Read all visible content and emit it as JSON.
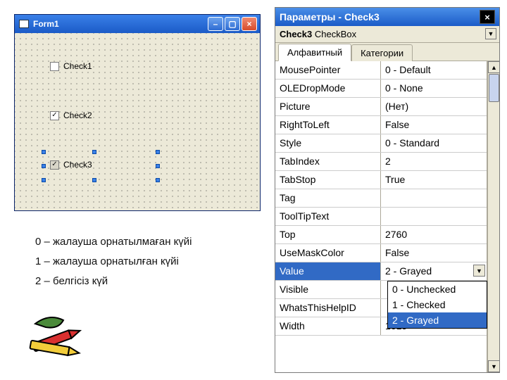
{
  "form": {
    "title": "Form1",
    "check1_label": "Check1",
    "check2_label": "Check2",
    "check3_label": "Check3"
  },
  "legend": {
    "l0": "0 – жалауша орнатылмаған күйі",
    "l1": "1 – жалауша орнатылған күйі",
    "l2": "2 – белгісіз күй"
  },
  "props": {
    "title": "Параметры - Check3",
    "object_name": "Check3",
    "object_type": "CheckBox",
    "tab_alpha": "Алфавитный",
    "tab_cat": "Категории",
    "rows": [
      {
        "name": "MousePointer",
        "val": "0 - Default"
      },
      {
        "name": "OLEDropMode",
        "val": "0 - None"
      },
      {
        "name": "Picture",
        "val": "(Нет)"
      },
      {
        "name": "RightToLeft",
        "val": "False"
      },
      {
        "name": "Style",
        "val": "0 - Standard"
      },
      {
        "name": "TabIndex",
        "val": "2"
      },
      {
        "name": "TabStop",
        "val": "True"
      },
      {
        "name": "Tag",
        "val": ""
      },
      {
        "name": "ToolTipText",
        "val": ""
      },
      {
        "name": "Top",
        "val": "2760"
      },
      {
        "name": "UseMaskColor",
        "val": "False"
      },
      {
        "name": "Value",
        "val": "2 - Grayed"
      },
      {
        "name": "Visible",
        "val": ""
      },
      {
        "name": "WhatsThisHelpID",
        "val": ""
      },
      {
        "name": "Width",
        "val": "1615"
      }
    ],
    "dropdown": {
      "opt0": "0 - Unchecked",
      "opt1": "1 - Checked",
      "opt2": "2 - Grayed"
    }
  }
}
